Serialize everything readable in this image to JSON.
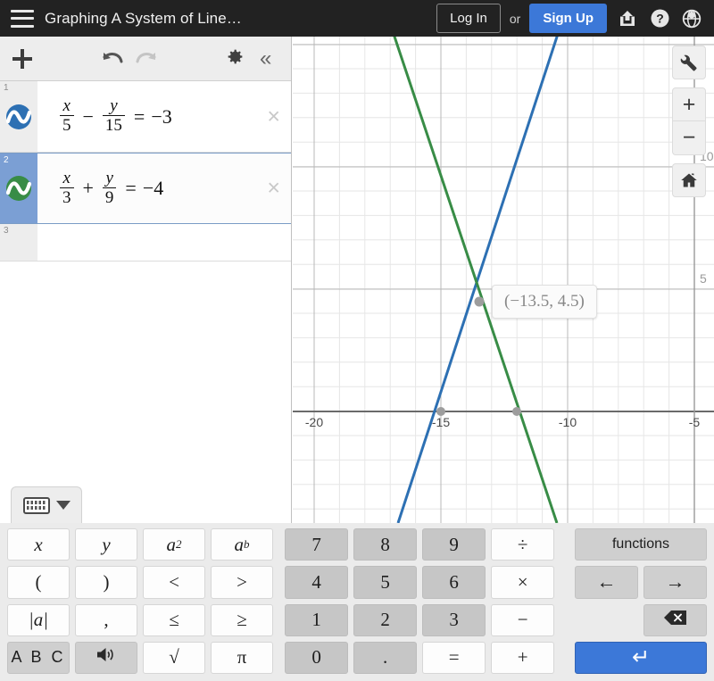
{
  "header": {
    "menu_icon": "hamburger-icon",
    "title": "Graphing A System of Line…",
    "login_label": "Log In",
    "or_label": "or",
    "signup_label": "Sign Up",
    "share_icon": "share-icon",
    "help_icon": "help-icon",
    "language_icon": "globe-icon",
    "bg_color": "#222222",
    "signup_color": "#3c78d8"
  },
  "expression_toolbar": {
    "add_label": "+",
    "undo_icon": "undo-icon",
    "redo_icon": "redo-icon",
    "settings_icon": "gear-icon",
    "collapse_icon": "double-chevron-left-icon",
    "collapse_label": "«"
  },
  "expressions": [
    {
      "index": "1",
      "latex": "x/5 - y/15 = -3",
      "num1": "x",
      "den1": "5",
      "op1": "−",
      "num2": "y",
      "den2": "15",
      "eq": "=",
      "rhs": "−3",
      "color": "#2d70b3",
      "selected": false,
      "delete_label": "×"
    },
    {
      "index": "2",
      "latex": "x/3 + y/9 = -4",
      "num1": "x",
      "den1": "3",
      "op1": "+",
      "num2": "y",
      "den2": "9",
      "eq": "=",
      "rhs": "−4",
      "color": "#388c46",
      "selected": true,
      "delete_label": "×"
    },
    {
      "index": "3",
      "latex": "",
      "selected": false
    }
  ],
  "graph": {
    "intersection_label": "(−13.5, 4.5)",
    "controls": {
      "wrench_icon": "wrench-icon",
      "zoom_in_label": "+",
      "zoom_out_label": "−",
      "home_icon": "home-icon"
    }
  },
  "chart_data": {
    "type": "line",
    "title": "",
    "xlabel": "",
    "ylabel": "",
    "grid": true,
    "legend": "none",
    "xlim": [
      -21.4,
      -4.0
    ],
    "ylim": [
      -1.3,
      18.6
    ],
    "xticks": [
      -20,
      -15,
      -10,
      -5
    ],
    "xtick_labels": [
      "-20",
      "-15",
      "-10",
      "-5"
    ],
    "yticks": [
      5,
      10
    ],
    "ytick_labels": [
      "5",
      "10"
    ],
    "minor_grid_step": 1,
    "major_grid_step": 5,
    "series": [
      {
        "name": "x/5 - y/15 = -3",
        "color": "#2d70b3",
        "equation": "x/5 - y/15 = -3",
        "slope": 3,
        "intercept": 45,
        "points": [
          [
            -15,
            0
          ],
          [
            -13.5,
            4.5
          ],
          [
            -13.0,
            6.0
          ]
        ]
      },
      {
        "name": "x/3 + y/9 = -4",
        "color": "#388c46",
        "equation": "x/3 + y/9 = -4",
        "slope": -3,
        "intercept": -36,
        "points": [
          [
            -12,
            0
          ],
          [
            -13.5,
            4.5
          ],
          [
            -14.0,
            6.0
          ]
        ]
      }
    ],
    "annotations": [
      {
        "label": "(−13.5, 4.5)",
        "x": -13.5,
        "y": 4.5,
        "type": "intersection-point"
      },
      {
        "label": "",
        "x": -15,
        "y": 0,
        "type": "x-intercept-point"
      },
      {
        "label": "",
        "x": -12,
        "y": 0,
        "type": "x-intercept-point"
      }
    ]
  },
  "keyboard_tab": {
    "keyboard_icon": "keyboard-icon",
    "caret_icon": "caret-down-icon"
  },
  "keypad": {
    "left": [
      {
        "label": "x",
        "style": "it"
      },
      {
        "label": "y",
        "style": "it"
      },
      {
        "label": "a2",
        "style": "sup",
        "base": "a",
        "exp": "2"
      },
      {
        "label": "ab",
        "style": "sup",
        "base": "a",
        "exp": "b"
      },
      {
        "label": "(",
        "style": "plain"
      },
      {
        "label": ")",
        "style": "plain"
      },
      {
        "label": "<",
        "style": "plain"
      },
      {
        "label": ">",
        "style": "plain"
      },
      {
        "label": "|a|",
        "style": "it"
      },
      {
        "label": ",",
        "style": "plain"
      },
      {
        "label": "≤",
        "style": "plain"
      },
      {
        "label": "≥",
        "style": "plain"
      },
      {
        "label": "A B C",
        "style": "abc-gray"
      },
      {
        "label": "🔊",
        "style": "speaker-gray"
      },
      {
        "label": "√",
        "style": "plain"
      },
      {
        "label": "π",
        "style": "plain"
      }
    ],
    "middle": [
      {
        "label": "7",
        "style": "gray"
      },
      {
        "label": "8",
        "style": "gray"
      },
      {
        "label": "9",
        "style": "gray"
      },
      {
        "label": "÷",
        "style": "plain"
      },
      {
        "label": "4",
        "style": "gray"
      },
      {
        "label": "5",
        "style": "gray"
      },
      {
        "label": "6",
        "style": "gray"
      },
      {
        "label": "×",
        "style": "plain"
      },
      {
        "label": "1",
        "style": "gray"
      },
      {
        "label": "2",
        "style": "gray"
      },
      {
        "label": "3",
        "style": "gray"
      },
      {
        "label": "−",
        "style": "plain"
      },
      {
        "label": "0",
        "style": "gray"
      },
      {
        "label": ".",
        "style": "gray"
      },
      {
        "label": "=",
        "style": "plain"
      },
      {
        "label": "+",
        "style": "plain"
      }
    ],
    "right": {
      "functions_label": "functions",
      "left_arrow_label": "←",
      "right_arrow_label": "→",
      "backspace_icon": "backspace-icon",
      "enter_icon": "enter-icon",
      "enter_label": "↵",
      "enter_color": "#3c78d8"
    }
  }
}
